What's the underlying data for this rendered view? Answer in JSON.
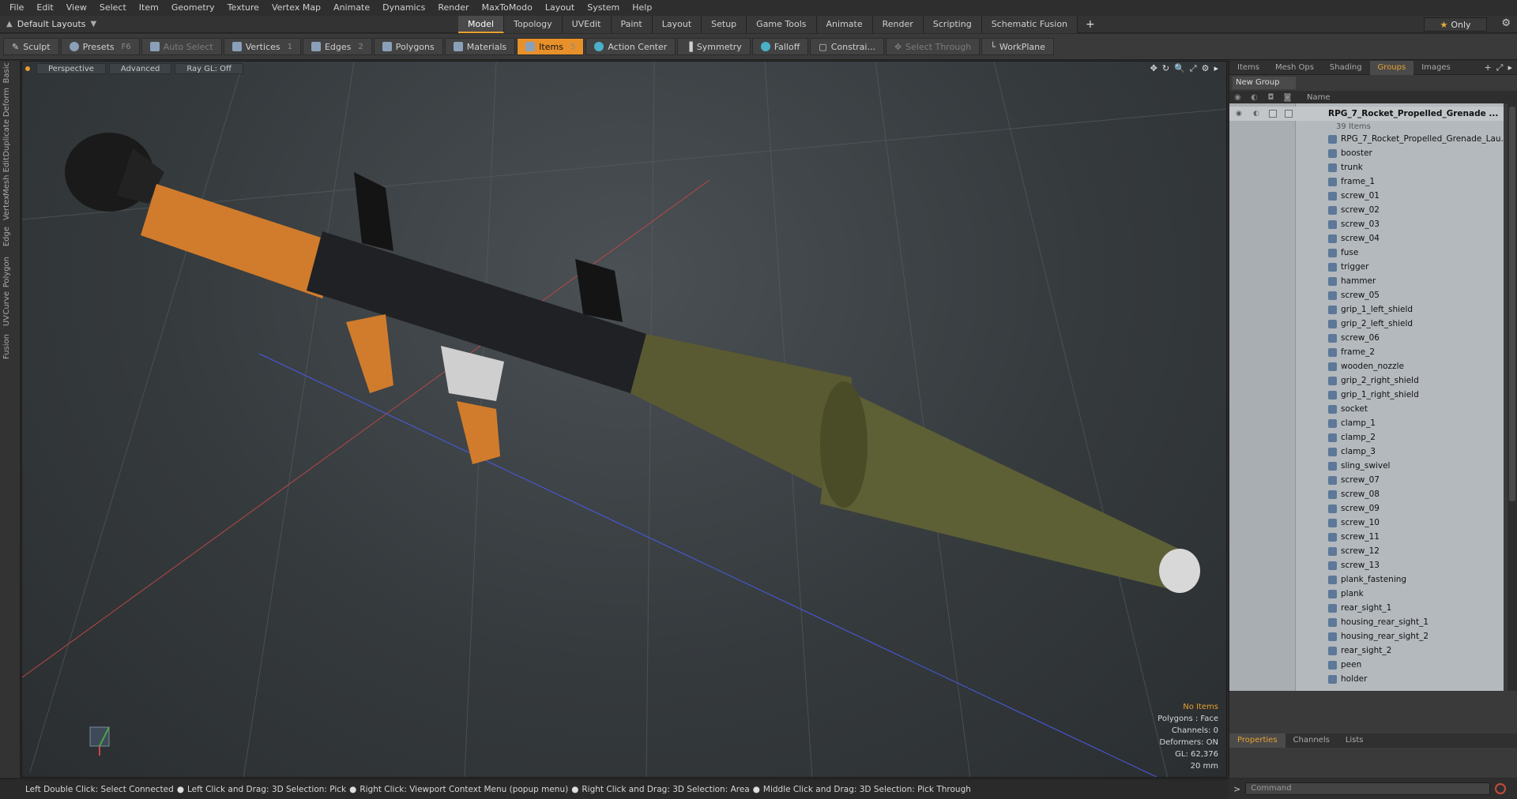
{
  "menu": [
    "File",
    "Edit",
    "View",
    "Select",
    "Item",
    "Geometry",
    "Texture",
    "Vertex Map",
    "Animate",
    "Dynamics",
    "Render",
    "MaxToModo",
    "Layout",
    "System",
    "Help"
  ],
  "layout_selector": "Default Layouts",
  "mode_tabs": [
    {
      "label": "Model",
      "active": true
    },
    {
      "label": "Topology",
      "active": false
    },
    {
      "label": "UVEdit",
      "active": false
    },
    {
      "label": "Paint",
      "active": false
    },
    {
      "label": "Layout",
      "active": false
    },
    {
      "label": "Setup",
      "active": false
    },
    {
      "label": "Game Tools",
      "active": false
    },
    {
      "label": "Animate",
      "active": false
    },
    {
      "label": "Render",
      "active": false
    },
    {
      "label": "Scripting",
      "active": false
    },
    {
      "label": "Schematic Fusion",
      "active": false
    }
  ],
  "only_label": "Only",
  "toolbar": {
    "sculpt": "Sculpt",
    "presets": "Presets",
    "presets_key": "F6",
    "auto_select": "Auto Select",
    "vertices": "Vertices",
    "vertices_key": "1",
    "edges": "Edges",
    "edges_key": "2",
    "polygons": "Polygons",
    "materials": "Materials",
    "items": "Items",
    "items_key": "5",
    "action_center": "Action Center",
    "symmetry": "Symmetry",
    "falloff": "Falloff",
    "constraints": "Constrai...",
    "select_through": "Select Through",
    "workplane": "WorkPlane"
  },
  "left_tabs": [
    "Basic",
    "Deform",
    "Duplicate",
    "Mesh Edit",
    "Vertex",
    "Edge",
    "Polygon",
    "Curve",
    "UV",
    "Fusion"
  ],
  "viewport": {
    "view": "Perspective",
    "shading": "Advanced",
    "raygl": "Ray GL: Off",
    "info": {
      "no_items": "No Items",
      "polygons": "Polygons : Face",
      "channels": "Channels: 0",
      "deformers": "Deformers: ON",
      "gl": "GL: 62,376",
      "scale": "20 mm"
    }
  },
  "right_panel": {
    "tabs": [
      {
        "label": "Items",
        "active": false
      },
      {
        "label": "Mesh Ops",
        "active": false
      },
      {
        "label": "Shading",
        "active": false
      },
      {
        "label": "Groups",
        "active": true
      },
      {
        "label": "Images",
        "active": false
      }
    ],
    "new_group": "New Group",
    "name_header": "Name",
    "root": "RPG_7_Rocket_Propelled_Grenade ...",
    "root_count": "39 Items",
    "items": [
      "RPG_7_Rocket_Propelled_Grenade_Lau...",
      "booster",
      "trunk",
      "frame_1",
      "screw_01",
      "screw_02",
      "screw_03",
      "screw_04",
      "fuse",
      "trigger",
      "hammer",
      "screw_05",
      "grip_1_left_shield",
      "grip_2_left_shield",
      "screw_06",
      "frame_2",
      "wooden_nozzle",
      "grip_2_right_shield",
      "grip_1_right_shield",
      "socket",
      "clamp_1",
      "clamp_2",
      "clamp_3",
      "sling_swivel",
      "screw_07",
      "screw_08",
      "screw_09",
      "screw_10",
      "screw_11",
      "screw_12",
      "screw_13",
      "plank_fastening",
      "plank",
      "rear_sight_1",
      "housing_rear_sight_1",
      "housing_rear_sight_2",
      "rear_sight_2",
      "peen",
      "holder"
    ],
    "bottom_tabs": [
      {
        "label": "Properties",
        "active": true
      },
      {
        "label": "Channels",
        "active": false
      },
      {
        "label": "Lists",
        "active": false
      }
    ]
  },
  "status": [
    "Left Double Click: Select Connected",
    "Left Click and Drag: 3D Selection: Pick",
    "Right Click: Viewport Context Menu (popup menu)",
    "Right Click and Drag: 3D Selection: Area",
    "Middle Click and Drag: 3D Selection: Pick Through"
  ],
  "command_placeholder": "Command",
  "colors": {
    "accent": "#e8902a",
    "viewport_bg": "#353a3d",
    "tree_bg": "#b4b9bd"
  }
}
